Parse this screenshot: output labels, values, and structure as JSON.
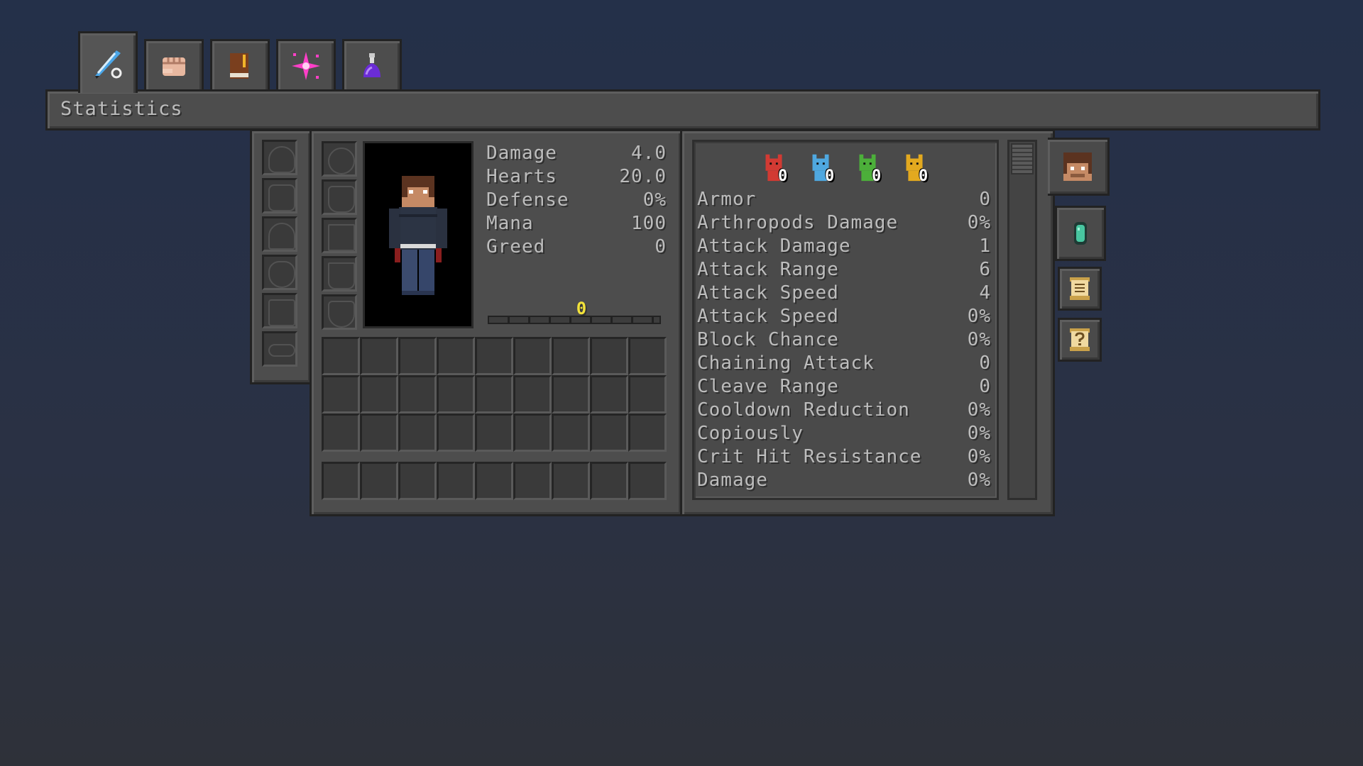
{
  "tabs": [
    {
      "name": "tab-statistics",
      "icon": "quill-icon"
    },
    {
      "name": "tab-skills",
      "icon": "fist-icon"
    },
    {
      "name": "tab-journal",
      "icon": "book-icon"
    },
    {
      "name": "tab-magic",
      "icon": "sparkle-icon"
    },
    {
      "name": "tab-potions",
      "icon": "potion-icon"
    }
  ],
  "header": {
    "title": "Statistics"
  },
  "basic_stats": [
    {
      "label": "Damage",
      "value": "4.0"
    },
    {
      "label": "Hearts",
      "value": "20.0"
    },
    {
      "label": "Defense",
      "value": "0%"
    },
    {
      "label": "Mana",
      "value": "100"
    },
    {
      "label": "Greed",
      "value": "0"
    }
  ],
  "xp": {
    "level": "0",
    "progress": 0.0
  },
  "gems": [
    {
      "color": "#d23a33",
      "count": "0"
    },
    {
      "color": "#4fa8e0",
      "count": "0"
    },
    {
      "color": "#4caf3a",
      "count": "0"
    },
    {
      "color": "#e3a91f",
      "count": "0"
    }
  ],
  "attributes": [
    {
      "label": "Armor",
      "value": "0"
    },
    {
      "label": "Arthropods Damage",
      "value": "0%"
    },
    {
      "label": "Attack Damage",
      "value": "1"
    },
    {
      "label": "Attack Range",
      "value": "6"
    },
    {
      "label": "Attack Speed",
      "value": "4"
    },
    {
      "label": "Attack Speed",
      "value": "0%"
    },
    {
      "label": "Block Chance",
      "value": "0%"
    },
    {
      "label": "Chaining Attack",
      "value": "0"
    },
    {
      "label": "Cleave Range",
      "value": "0"
    },
    {
      "label": "Cooldown Reduction",
      "value": "0%"
    },
    {
      "label": "Copiously",
      "value": "0%"
    },
    {
      "label": "Crit Hit Resistance",
      "value": "0%"
    },
    {
      "label": "Damage",
      "value": "0%"
    }
  ],
  "side_buttons": [
    "player-head-icon",
    "gem-icon",
    "scroll-icon",
    "help-scroll-icon"
  ],
  "colors": {
    "xp_text": "#f2e23a",
    "stat_text": "#bdbdbd",
    "panel": "#4d4d4d"
  }
}
